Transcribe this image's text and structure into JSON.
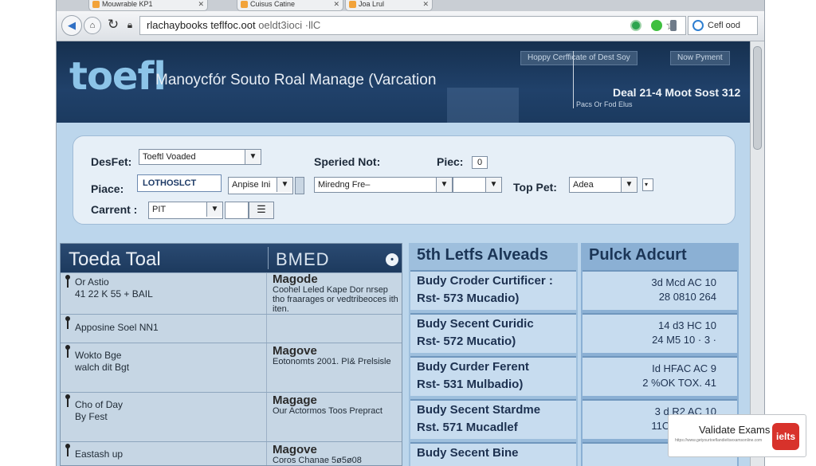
{
  "browser": {
    "tabs": [
      {
        "label": "Mouwrable KP1"
      },
      {
        "label": "Cuisus Catine"
      },
      {
        "label": "Joa Lrul"
      }
    ],
    "url_host": "rlachaybooks teflfoc.oot",
    "url_rest": "oeldt3ioci ·llC",
    "search_text": "Cefl  ood"
  },
  "header": {
    "logo": "toefl",
    "title": "Manoycfór Souto Roal Manage (Varcation",
    "buttons": [
      "Hoppy Cerfficate of Dest Soy",
      "Now Pyment"
    ],
    "date": "Deal 21-4 Moot Sost 312",
    "sub": "Pacs Or Fod Elus"
  },
  "form": {
    "desfet_label": "DesFet:",
    "desfet_value": "Toeftl Voaded",
    "spered_label": "Speried Not:",
    "piec_label": "Piec:",
    "piec_value": "0",
    "place_label": "Piace:",
    "place_value": "LOTHOSLCT",
    "anpise_value": "Anpise Ini",
    "miredng_value": "Miredng Fre–",
    "toppet_label": "Top Pet:",
    "toppet_value": "Adea",
    "current_label": "Carrent :",
    "current_value": "PIT"
  },
  "table": {
    "left_head": "Toeda Toal",
    "mid_head": "BMED",
    "col2_head": "5th Letfs Alveads",
    "col3_head": "Pulck Adcurt",
    "left_rows": [
      {
        "c1a": "Or Astio",
        "c1b": "41 22 K 55 + BAIL",
        "title": "Magode",
        "desc": "Coohel Leled Kape Dor nrsep tho fraarages or vedtribeoces ith iten."
      },
      {
        "c1a": "Apposine Soel NN1",
        "c1b": "",
        "title": "",
        "desc": ""
      },
      {
        "c1a": "Wokto Bge",
        "c1b": "walch dit Bgt",
        "title": "Magove",
        "desc": "Eotonomts 2001. PI& Prelsisle"
      },
      {
        "c1a": "Cho of Day",
        "c1b": "By Fest",
        "title": "Magage",
        "desc": "Our Actormos Toos Prepract"
      },
      {
        "c1a": "Eastash up",
        "c1b": "",
        "title": "Magove",
        "desc": "Coros Chanae 5ø5ø08"
      }
    ],
    "mid_rows": [
      {
        "a": "Budy Croder Curtificer :",
        "b": "Rst- 573 Mucadio)"
      },
      {
        "a": "Budy Secent Curidic",
        "b": "Rst- 572 Mucatio)"
      },
      {
        "a": "Budy Curder Ferent",
        "b": "Rst- 531 Mulbadio)"
      },
      {
        "a": "Budy Secent Stardme",
        "b": "Rst. 571 Mucadlef"
      },
      {
        "a": "Budy Secent Bine",
        "b": ""
      }
    ],
    "right_rows": [
      {
        "a": "3d Mcd AC 10",
        "b": "28 0810 264"
      },
      {
        "a": "14 d3 HC 10",
        "b": "24 M5 10 · 3 ·"
      },
      {
        "a": "Id HFAC AC 9",
        "b": "2 %OK TOX. 41"
      },
      {
        "a": "3 d R2 AC 10",
        "b": "11OL 13X· 1C"
      },
      {
        "a": "",
        "b": ""
      }
    ]
  },
  "watermark": {
    "title": "Validate Exams",
    "url": "https://www.getyourtoeflandieltsexamsonline.com",
    "logo_text": "ielts"
  },
  "colors": {
    "header_bg": "#1b3a5f",
    "logo": "#8cc4e8",
    "page_bg": "#bcd6ec",
    "accent_red": "#d8322b"
  }
}
